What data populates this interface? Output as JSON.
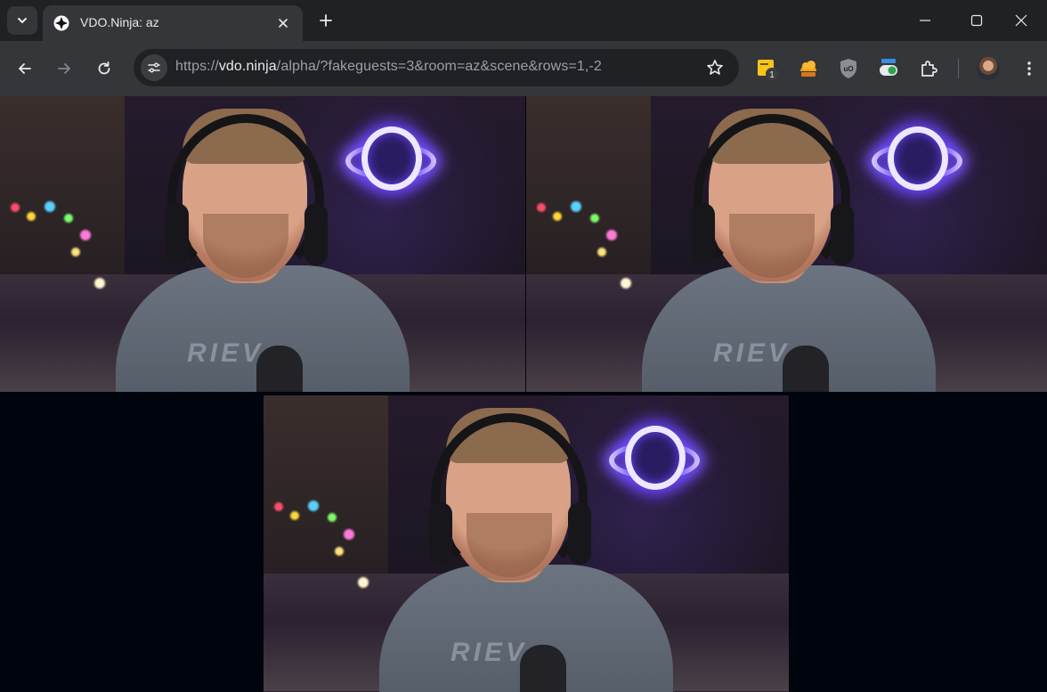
{
  "tab": {
    "title": "VDO.Ninja: az",
    "close_icon": "close-icon",
    "favicon": "vdo-ninja-favicon-icon"
  },
  "address_bar": {
    "url_prefix": "https://",
    "url_host": "vdo.ninja",
    "url_rest": "/alpha/?fakeguests=3&room=az&scene&rows=1,-2"
  },
  "extensions": {
    "badge_count": "1",
    "items": [
      "sticky-notes-icon",
      "cookie-icon",
      "ublock-origin-icon",
      "chat-toggle-icon",
      "extensions-puzzle-icon"
    ]
  },
  "scene": {
    "guest_count": 3,
    "rows": "1,-2",
    "background_color": "#00040d",
    "shirt_text": "RIEV"
  },
  "colors": {
    "chrome_dark": "#202124",
    "chrome_toolbar": "#35363a",
    "text": "#e8eaed",
    "neon": "#7c55ff"
  }
}
